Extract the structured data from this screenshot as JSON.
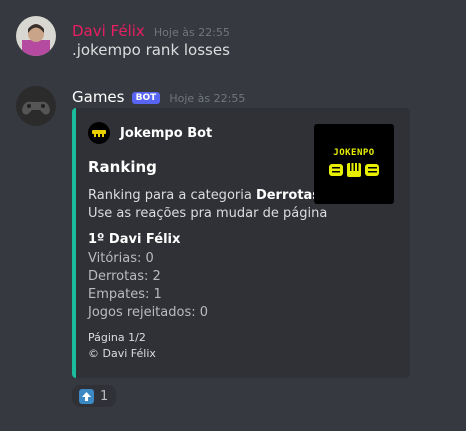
{
  "message1": {
    "username": "Davi Félix",
    "username_color": "#e91e63",
    "timestamp": "Hoje às 22:55",
    "content": ".jokempo rank losses"
  },
  "message2": {
    "username": "Games",
    "username_color": "#ffffff",
    "bot_tag": "BOT",
    "timestamp": "Hoje às 22:55",
    "embed": {
      "accent_color": "#1abc9c",
      "author_icon": "mustache-icon",
      "author": "Jokempo Bot",
      "title": "Ranking",
      "desc_prefix": "Ranking para a categoria ",
      "desc_bold": "Derrotas",
      "desc_line2": "Use as reações pra mudar de página",
      "field_name": "1º Davi Félix",
      "stats": [
        "Vitórias: 0",
        "Derrotas: 2",
        "Empates: 1",
        "Jogos rejeitados: 0"
      ],
      "footer_page": "Página 1/2",
      "footer_copyright": "© Davi Félix",
      "thumbnail_text": "JOKENPO"
    },
    "reaction": {
      "emoji": "up-arrow-icon",
      "count": "1"
    }
  }
}
